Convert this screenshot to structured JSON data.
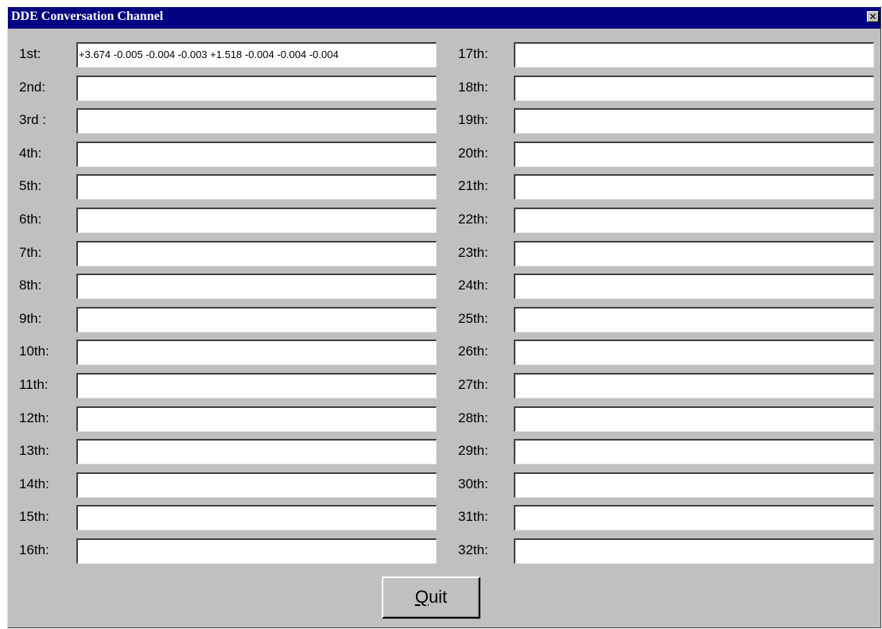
{
  "window": {
    "title": "DDE Conversation Channel",
    "close_glyph": "✕"
  },
  "channels_left": [
    {
      "label": "1st:",
      "value": "+3.674 -0.005 -0.004 -0.003 +1.518 -0.004 -0.004 -0.004"
    },
    {
      "label": "2nd:",
      "value": ""
    },
    {
      "label": "3rd :",
      "value": ""
    },
    {
      "label": "4th:",
      "value": ""
    },
    {
      "label": "5th:",
      "value": ""
    },
    {
      "label": "6th:",
      "value": ""
    },
    {
      "label": "7th:",
      "value": ""
    },
    {
      "label": "8th:",
      "value": ""
    },
    {
      "label": "9th:",
      "value": ""
    },
    {
      "label": "10th:",
      "value": ""
    },
    {
      "label": "11th:",
      "value": ""
    },
    {
      "label": "12th:",
      "value": ""
    },
    {
      "label": "13th:",
      "value": ""
    },
    {
      "label": "14th:",
      "value": ""
    },
    {
      "label": "15th:",
      "value": ""
    },
    {
      "label": "16th:",
      "value": ""
    }
  ],
  "channels_right": [
    {
      "label": "17th:",
      "value": ""
    },
    {
      "label": "18th:",
      "value": ""
    },
    {
      "label": "19th:",
      "value": ""
    },
    {
      "label": "20th:",
      "value": ""
    },
    {
      "label": "21th:",
      "value": ""
    },
    {
      "label": "22th:",
      "value": ""
    },
    {
      "label": "23th:",
      "value": ""
    },
    {
      "label": "24th:",
      "value": ""
    },
    {
      "label": "25th:",
      "value": ""
    },
    {
      "label": "26th:",
      "value": ""
    },
    {
      "label": "27th:",
      "value": ""
    },
    {
      "label": "28th:",
      "value": ""
    },
    {
      "label": "29th:",
      "value": ""
    },
    {
      "label": "30th:",
      "value": ""
    },
    {
      "label": "31th:",
      "value": ""
    },
    {
      "label": "32th:",
      "value": ""
    }
  ],
  "quit_button": {
    "mnemonic": "Q",
    "rest": "uit"
  }
}
